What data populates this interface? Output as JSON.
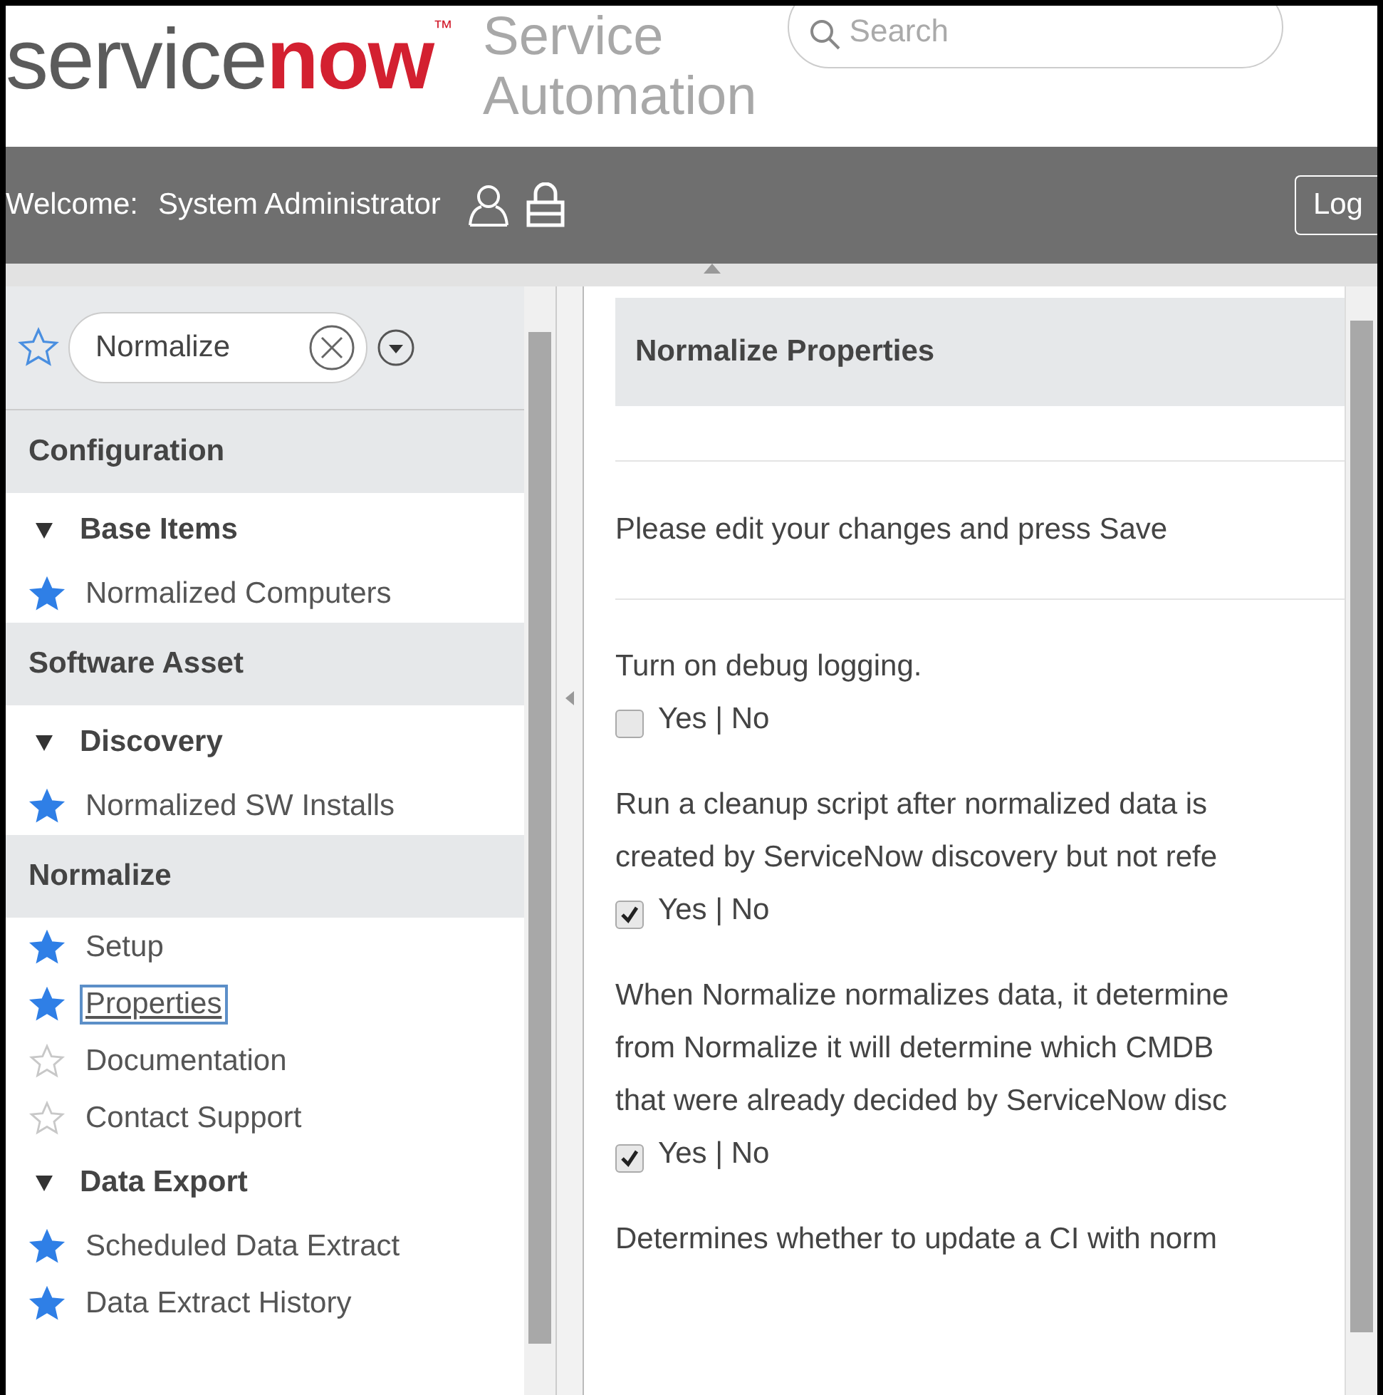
{
  "header": {
    "logo_text": "service",
    "logo_accent": "now",
    "logo_mark": "™",
    "product": "Service\nAutomation",
    "search": {
      "placeholder": "Search"
    }
  },
  "user_bar": {
    "welcome_label": "Welcome:",
    "user_name": "System Administrator",
    "login_button": "Log"
  },
  "sidebar": {
    "filter": {
      "value": "Normalize"
    },
    "items": [
      {
        "kind": "section",
        "label": "Configuration"
      },
      {
        "kind": "group",
        "label": "Base Items",
        "expanded": true
      },
      {
        "kind": "leaf",
        "label": "Normalized Computers",
        "starred": true,
        "selected": false
      },
      {
        "kind": "section",
        "label": "Software Asset"
      },
      {
        "kind": "group",
        "label": "Discovery",
        "expanded": true
      },
      {
        "kind": "leaf",
        "label": "Normalized SW Installs",
        "starred": true,
        "selected": false
      },
      {
        "kind": "section",
        "label": "Normalize"
      },
      {
        "kind": "leaf",
        "label": "Setup",
        "starred": true,
        "selected": false
      },
      {
        "kind": "leaf",
        "label": "Properties",
        "starred": true,
        "selected": true
      },
      {
        "kind": "leaf",
        "label": "Documentation",
        "starred": false,
        "selected": false
      },
      {
        "kind": "leaf",
        "label": "Contact Support",
        "starred": false,
        "selected": false
      },
      {
        "kind": "group",
        "label": "Data Export",
        "expanded": true
      },
      {
        "kind": "leaf",
        "label": "Scheduled Data Extract",
        "starred": true,
        "selected": false
      },
      {
        "kind": "leaf",
        "label": "Data Extract History",
        "starred": true,
        "selected": false
      }
    ]
  },
  "main": {
    "title": "Normalize Properties",
    "instruction": "Please edit your changes and press Save",
    "properties": [
      {
        "description": "Turn on debug logging.",
        "option_label": "Yes | No",
        "checked": false
      },
      {
        "description": "Run a cleanup script after normalized data is\ncreated by ServiceNow discovery but not refe",
        "option_label": "Yes | No",
        "checked": true
      },
      {
        "description": "When Normalize normalizes data, it determine\nfrom Normalize it will determine which CMDB\nthat were already decided by ServiceNow disc",
        "option_label": "Yes | No",
        "checked": true
      },
      {
        "description": "Determines whether to update a CI with norm"
      }
    ]
  }
}
